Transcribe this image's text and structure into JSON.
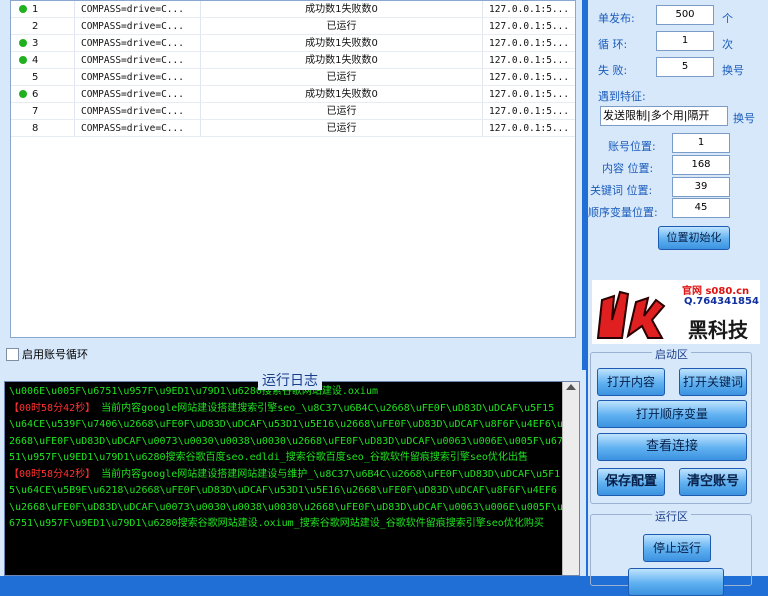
{
  "table": {
    "rows": [
      {
        "num": "1",
        "cmd": "COMPASS=drive=C...",
        "status": "成功数1失败数0",
        "ip": "127.0.0.1:5...",
        "active": true
      },
      {
        "num": "2",
        "cmd": "COMPASS=drive=C...",
        "status": "已运行",
        "ip": "127.0.0.1:5...",
        "active": false
      },
      {
        "num": "3",
        "cmd": "COMPASS=drive=C...",
        "status": "成功数1失败数0",
        "ip": "127.0.0.1:5...",
        "active": true
      },
      {
        "num": "4",
        "cmd": "COMPASS=drive=C...",
        "status": "成功数1失败数0",
        "ip": "127.0.0.1:5...",
        "active": true
      },
      {
        "num": "5",
        "cmd": "COMPASS=drive=C...",
        "status": "已运行",
        "ip": "127.0.0.1:5...",
        "active": false
      },
      {
        "num": "6",
        "cmd": "COMPASS=drive=C...",
        "status": "成功数1失败数0",
        "ip": "127.0.0.1:5...",
        "active": true
      },
      {
        "num": "7",
        "cmd": "COMPASS=drive=C...",
        "status": "已运行",
        "ip": "127.0.0.1:5...",
        "active": false
      },
      {
        "num": "8",
        "cmd": "COMPASS=drive=C...",
        "status": "已运行",
        "ip": "127.0.0.1:5...",
        "active": false
      }
    ]
  },
  "account_cycle": {
    "label": "启用账号循环"
  },
  "settings": {
    "single_publish": {
      "label": "单发布:",
      "value": "500",
      "unit": "个"
    },
    "loop": {
      "label": "循  环:",
      "value": "1",
      "unit": "次"
    },
    "fail": {
      "label": "失  败:",
      "value": "5",
      "unit": "换号"
    },
    "feature_label": "遇到特征:",
    "feature_value": "发送限制|多个用|隔开",
    "feature_unit": "换号",
    "account_pos": {
      "label": "账号位置:",
      "value": "1"
    },
    "content_pos": {
      "label": "内容 位置:",
      "value": "168"
    },
    "keyword_pos": {
      "label": "关键词 位置:",
      "value": "39"
    },
    "seq_pos": {
      "label": "顺序变量位置:",
      "value": "45"
    },
    "init_button": "位置初始化"
  },
  "logo": {
    "site": "官网 s080.cn",
    "qq": "Q.764341854",
    "brand": "黑科技"
  },
  "start_area": {
    "title": "启动区",
    "open_content": "打开内容",
    "open_keywords": "打开关键词",
    "open_seq": "打开顺序变量",
    "view_conn": "查看连接",
    "save_config": "保存配置",
    "clear_accounts": "清空账号"
  },
  "run_area": {
    "title": "运行区",
    "stop": "停止运行"
  },
  "log": {
    "title": "运行日志",
    "lines": [
      {
        "t": "\\u006E\\u005F\\u6751\\u957F\\u9ED1\\u79D1\\u6280搜索谷歌网站建设.oxium",
        "c": "g"
      },
      {
        "t": "【00时58分42秒】",
        "c": "r",
        "rest": " 当前内容google网站建设搭建搜索引擎seo_\\u8C37\\u6B4C\\u2668\\uFE0F\\uD83D\\uDCAF\\u5F15\\u64CE\\u539F\\u7406\\u2668\\uFE0F\\uD83D\\uDCAF\\u53D1\\u5E16\\u2668\\uFE0F\\uD83D\\uDCAF\\u8F6F\\u4EF6\\u2668\\uFE0F\\uD83D\\uDCAF\\u0073\\u0030\\u0038\\u0030\\u2668\\uFE0F\\uD83D\\uDCAF\\u0063\\u006E\\u005F\\u6751\\u957F\\u9ED1\\u79D1\\u6280搜索谷歌百度seo.edldi_搜索谷歌百度seo_谷歌软件留痕搜索引擎seo优化出售"
      },
      {
        "t": "【00时58分42秒】",
        "c": "r",
        "rest": " 当前内容google网站建设搭建网站建设与维护_\\u8C37\\u6B4C\\u2668\\uFE0F\\uD83D\\uDCAF\\u5F15\\u64CE\\u5B9E\\u6218\\u2668\\uFE0F\\uD83D\\uDCAF\\u53D1\\u5E16\\u2668\\uFE0F\\uD83D\\uDCAF\\u8F6F\\u4EF6\\u2668\\uFE0F\\uD83D\\uDCAF\\u0073\\u0030\\u0038\\u0030\\u2668\\uFE0F\\uD83D\\uDCAF\\u0063\\u006E\\u005F\\u6751\\u957F\\u9ED1\\u79D1\\u6280搜索谷歌网站建设.oxium_搜索谷歌网站建设_谷歌软件留痕搜索引擎seo优化购买"
      }
    ]
  },
  "colors": {
    "bg": "#1f6fd6",
    "panel": "#d8e8fb",
    "log_bg": "#000000",
    "log_text": "#20e020",
    "log_time": "#ff3030",
    "status_dot": "#20b020"
  }
}
